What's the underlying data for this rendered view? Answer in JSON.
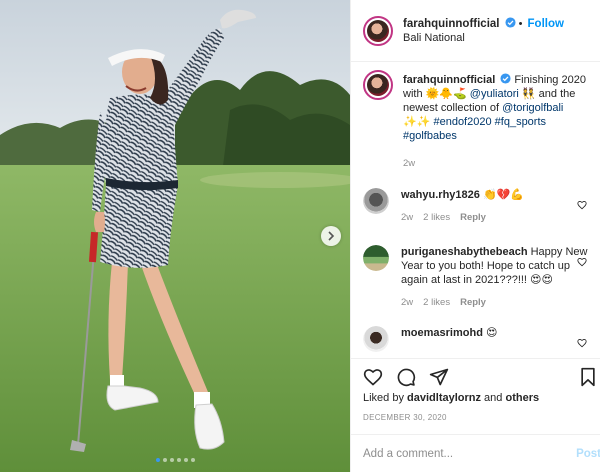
{
  "post": {
    "username": "farahquinnofficial",
    "follow_label": "Follow",
    "location": "Bali National",
    "caption_username": "farahquinnofficial",
    "caption_parts": [
      "Finishing 2020 with ",
      "🌞🐥⛳",
      " ",
      "@yuliatori",
      " ",
      "👯",
      " and the newest collection of ",
      "@torigolfbali",
      " ",
      "✨✨",
      " ",
      "#endof2020",
      " ",
      "#fq_sports",
      " ",
      "#golfbabes"
    ],
    "caption_age": "2w",
    "carousel_count": 6,
    "carousel_active": 1
  },
  "comments": [
    {
      "username": "wahyu.rhy1826",
      "text": "👏💔💪",
      "age": "2w",
      "likes": "2 likes",
      "reply": "Reply"
    },
    {
      "username": "puriganeshabythebeach",
      "text": "Happy New Year to you both! Hope to catch up again at last in 2021???!!! 😍😍",
      "age": "2w",
      "likes": "2 likes",
      "reply": "Reply"
    },
    {
      "username": "moemasrimohd",
      "text": "😍",
      "age": "",
      "likes": "",
      "reply": ""
    }
  ],
  "liked_by": {
    "prefix": "Liked by ",
    "user": "davidltaylornz",
    "middle": " and ",
    "others": "others"
  },
  "date": "DECEMBER 30, 2020",
  "add_comment": {
    "placeholder": "Add a comment...",
    "post_label": "Post"
  },
  "colors": {
    "accent": "#0095f6",
    "link": "#00376b",
    "muted": "#8e8e8e",
    "ring": "#c13584"
  },
  "icons": [
    "verified-icon",
    "heart-icon",
    "comment-icon",
    "share-icon",
    "save-icon",
    "chevron-right-icon"
  ]
}
